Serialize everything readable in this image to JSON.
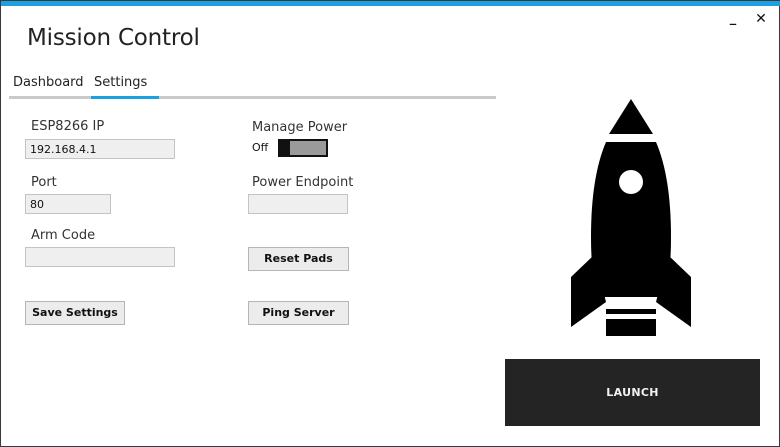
{
  "window": {
    "title": "Mission Control",
    "minimize_glyph": "_",
    "close_glyph": "✕",
    "accent_color": "#1ba1e2"
  },
  "tabs": [
    {
      "label": "Dashboard",
      "active": false
    },
    {
      "label": "Settings",
      "active": true
    }
  ],
  "settings": {
    "esp_ip": {
      "label": "ESP8266 IP",
      "value": "192.168.4.1"
    },
    "port": {
      "label": "Port",
      "value": "80"
    },
    "arm_code": {
      "label": "Arm Code",
      "value": ""
    },
    "manage_power": {
      "label": "Manage Power",
      "state_label": "Off",
      "enabled": false
    },
    "power_endpoint": {
      "label": "Power Endpoint",
      "value": ""
    },
    "reset_pads_label": "Reset Pads",
    "save_settings_label": "Save Settings",
    "ping_server_label": "Ping Server"
  },
  "launch": {
    "label": "LAUNCH",
    "icon": "rocket-icon"
  }
}
